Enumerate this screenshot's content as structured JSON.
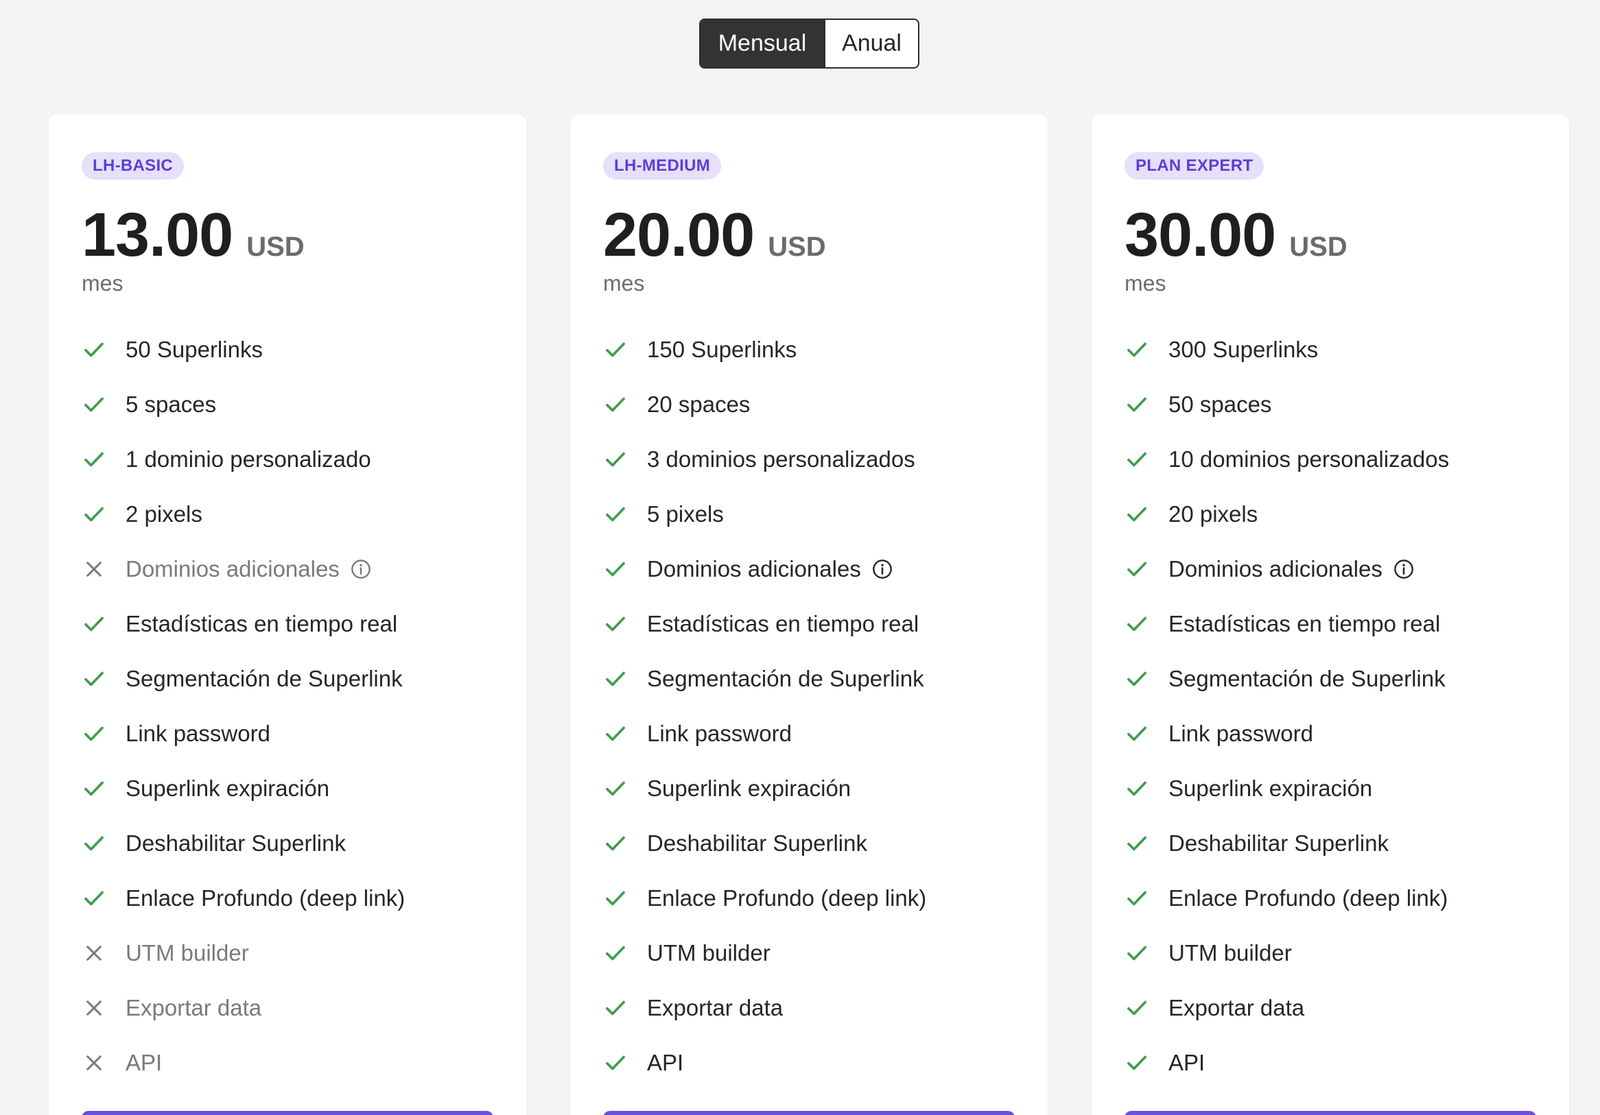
{
  "billing_toggle": {
    "monthly_label": "Mensual",
    "annual_label": "Anual",
    "selected": "Mensual"
  },
  "colors": {
    "accent": "#6a4fe0",
    "badge_bg": "#e6e0fb",
    "badge_text": "#5a3fd8",
    "check": "#3f9d4f",
    "cross": "#7a7a7a",
    "background": "#f4f4f4"
  },
  "icons": {
    "included": "check-icon",
    "excluded": "cross-icon",
    "info": "info-icon"
  },
  "plans": [
    {
      "badge": "LH-BASIC",
      "price": "13.00",
      "currency": "USD",
      "period": "mes",
      "features": [
        {
          "label": "50 Superlinks",
          "included": true,
          "info": false
        },
        {
          "label": "5 spaces",
          "included": true,
          "info": false
        },
        {
          "label": "1 dominio personalizado",
          "included": true,
          "info": false
        },
        {
          "label": "2 pixels",
          "included": true,
          "info": false
        },
        {
          "label": "Dominios adicionales",
          "included": false,
          "info": true
        },
        {
          "label": "Estadísticas en tiempo real",
          "included": true,
          "info": false
        },
        {
          "label": "Segmentación de Superlink",
          "included": true,
          "info": false
        },
        {
          "label": "Link password",
          "included": true,
          "info": false
        },
        {
          "label": "Superlink expiración",
          "included": true,
          "info": false
        },
        {
          "label": "Deshabilitar Superlink",
          "included": true,
          "info": false
        },
        {
          "label": "Enlace Profundo (deep link)",
          "included": true,
          "info": false
        },
        {
          "label": "UTM builder",
          "included": false,
          "info": false
        },
        {
          "label": "Exportar data",
          "included": false,
          "info": false
        },
        {
          "label": "API",
          "included": false,
          "info": false
        }
      ]
    },
    {
      "badge": "LH-MEDIUM",
      "price": "20.00",
      "currency": "USD",
      "period": "mes",
      "features": [
        {
          "label": "150 Superlinks",
          "included": true,
          "info": false
        },
        {
          "label": "20 spaces",
          "included": true,
          "info": false
        },
        {
          "label": "3 dominios personalizados",
          "included": true,
          "info": false
        },
        {
          "label": "5 pixels",
          "included": true,
          "info": false
        },
        {
          "label": "Dominios adicionales",
          "included": true,
          "info": true
        },
        {
          "label": "Estadísticas en tiempo real",
          "included": true,
          "info": false
        },
        {
          "label": "Segmentación de Superlink",
          "included": true,
          "info": false
        },
        {
          "label": "Link password",
          "included": true,
          "info": false
        },
        {
          "label": "Superlink expiración",
          "included": true,
          "info": false
        },
        {
          "label": "Deshabilitar Superlink",
          "included": true,
          "info": false
        },
        {
          "label": "Enlace Profundo (deep link)",
          "included": true,
          "info": false
        },
        {
          "label": "UTM builder",
          "included": true,
          "info": false
        },
        {
          "label": "Exportar data",
          "included": true,
          "info": false
        },
        {
          "label": "API",
          "included": true,
          "info": false
        }
      ]
    },
    {
      "badge": "PLAN EXPERT",
      "price": "30.00",
      "currency": "USD",
      "period": "mes",
      "features": [
        {
          "label": "300 Superlinks",
          "included": true,
          "info": false
        },
        {
          "label": "50 spaces",
          "included": true,
          "info": false
        },
        {
          "label": "10 dominios personalizados",
          "included": true,
          "info": false
        },
        {
          "label": "20 pixels",
          "included": true,
          "info": false
        },
        {
          "label": "Dominios adicionales",
          "included": true,
          "info": true
        },
        {
          "label": "Estadísticas en tiempo real",
          "included": true,
          "info": false
        },
        {
          "label": "Segmentación de Superlink",
          "included": true,
          "info": false
        },
        {
          "label": "Link password",
          "included": true,
          "info": false
        },
        {
          "label": "Superlink expiración",
          "included": true,
          "info": false
        },
        {
          "label": "Deshabilitar Superlink",
          "included": true,
          "info": false
        },
        {
          "label": "Enlace Profundo (deep link)",
          "included": true,
          "info": false
        },
        {
          "label": "UTM builder",
          "included": true,
          "info": false
        },
        {
          "label": "Exportar data",
          "included": true,
          "info": false
        },
        {
          "label": "API",
          "included": true,
          "info": false
        }
      ]
    }
  ]
}
